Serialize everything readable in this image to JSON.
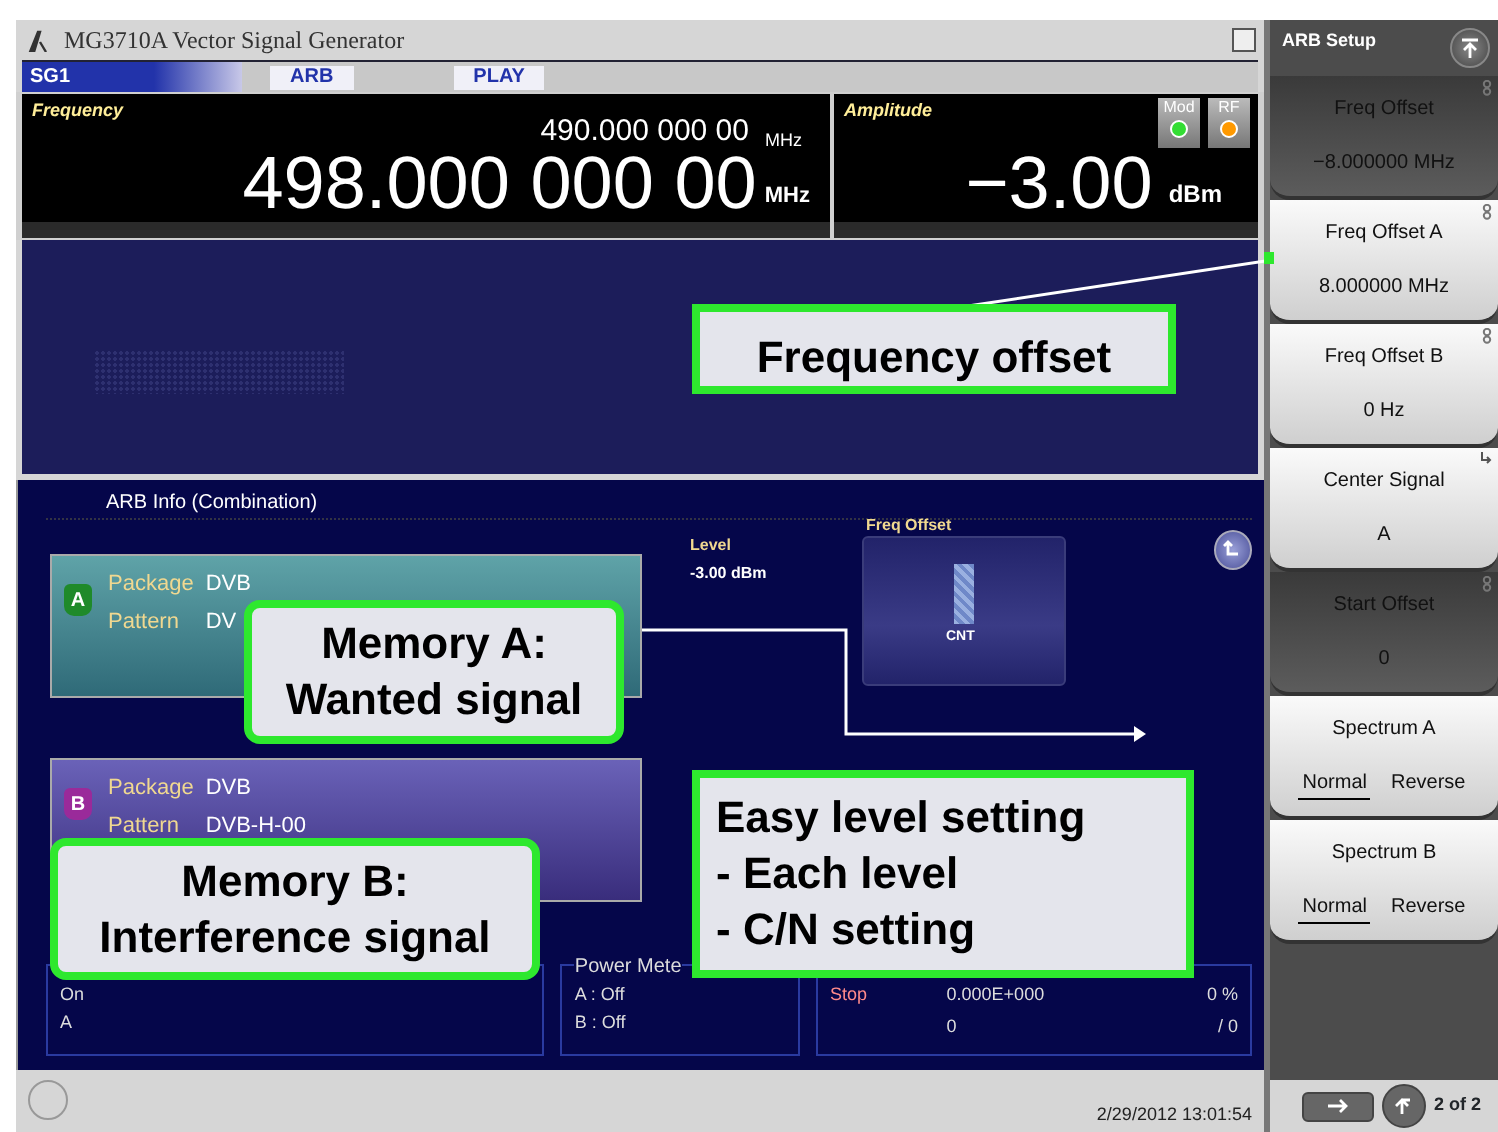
{
  "window": {
    "title": "MG3710A  Vector Signal Generator"
  },
  "status_tabs": [
    {
      "label": "SG1",
      "selected": true
    },
    {
      "label": "ARB",
      "selected": false
    },
    {
      "label": "PLAY",
      "selected": false
    }
  ],
  "frequency": {
    "label": "Frequency",
    "reference": "490.000 000 00",
    "reference_unit": "MHz",
    "value": "498.000 000 00",
    "unit": "MHz"
  },
  "amplitude": {
    "label": "Amplitude",
    "value": "−3.00",
    "unit": "dBm",
    "indicators": [
      {
        "label": "Mod",
        "on": true,
        "color": "#33dd33"
      },
      {
        "label": "RF",
        "on": true,
        "color": "#ff9900"
      }
    ]
  },
  "arb_info": {
    "title": "ARB Info (Combination)",
    "memories": [
      {
        "letter": "A",
        "package_label": "Package",
        "package": "DVB",
        "pattern_label": "Pattern",
        "pattern": "DV"
      },
      {
        "letter": "B",
        "package_label": "Package",
        "package": "DVB",
        "pattern_label": "Pattern",
        "pattern": "DVB-H-00"
      }
    ],
    "level_label": "Level",
    "level": "-3.00 dBm",
    "freq_offset_label": "Freq Offset",
    "marker": "CNT"
  },
  "panels": [
    {
      "lines": [
        "On",
        "A"
      ]
    },
    {
      "title": "Power Mete",
      "lines": [
        "A :  Off",
        "B :  Off"
      ]
    },
    {
      "rows": [
        [
          "Stop",
          "0.000E+000",
          "0 %"
        ],
        [
          "",
          "0",
          "/ 0"
        ]
      ]
    }
  ],
  "status_bar": {
    "datetime": "2/29/2012 13:01:54"
  },
  "softkeys": {
    "title": "ARB Setup",
    "keys": [
      {
        "kind": "knob",
        "label": "Freq Offset",
        "value": "−8.000000 MHz",
        "disabled": true
      },
      {
        "kind": "knob",
        "label": "Freq Offset A",
        "value": "8.000000 MHz",
        "disabled": false
      },
      {
        "kind": "knob",
        "label": "Freq Offset B",
        "value": "0 Hz",
        "disabled": false
      },
      {
        "kind": "submenu",
        "label": "Center Signal",
        "value": "A",
        "disabled": false
      },
      {
        "kind": "knob",
        "label": "Start Offset",
        "value": "0",
        "disabled": true
      },
      {
        "kind": "toggle",
        "label": "Spectrum A",
        "options": [
          {
            "label": "Normal",
            "selected": true
          },
          {
            "label": "Reverse",
            "selected": false
          }
        ]
      },
      {
        "kind": "toggle",
        "label": "Spectrum B",
        "options": [
          {
            "label": "Normal",
            "selected": true
          },
          {
            "label": "Reverse",
            "selected": false
          }
        ]
      }
    ],
    "page": "2 of 2"
  },
  "callouts": [
    {
      "lines": [
        "Frequency offset"
      ]
    },
    {
      "lines": [
        "Memory A:",
        "Wanted signal"
      ]
    },
    {
      "lines": [
        "Memory B:",
        "Interference signal"
      ]
    },
    {
      "lines": [
        "Easy level setting",
        "- Each level",
        "- C/N setting"
      ]
    }
  ]
}
